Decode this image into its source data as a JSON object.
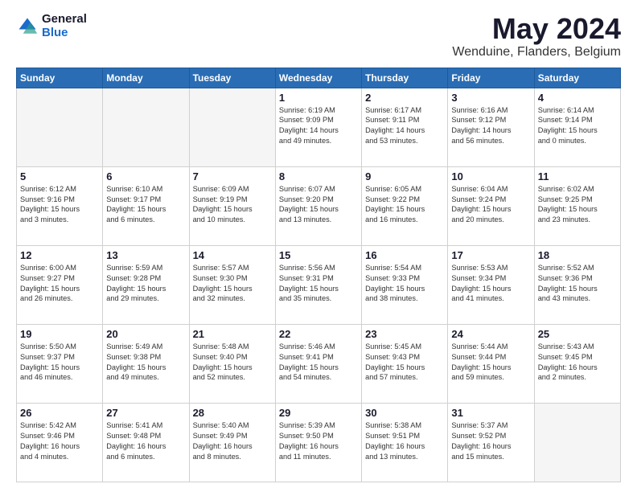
{
  "header": {
    "logo_general": "General",
    "logo_blue": "Blue",
    "month_title": "May 2024",
    "location": "Wenduine, Flanders, Belgium"
  },
  "days_of_week": [
    "Sunday",
    "Monday",
    "Tuesday",
    "Wednesday",
    "Thursday",
    "Friday",
    "Saturday"
  ],
  "weeks": [
    [
      {
        "day": "",
        "info": ""
      },
      {
        "day": "",
        "info": ""
      },
      {
        "day": "",
        "info": ""
      },
      {
        "day": "1",
        "info": "Sunrise: 6:19 AM\nSunset: 9:09 PM\nDaylight: 14 hours\nand 49 minutes."
      },
      {
        "day": "2",
        "info": "Sunrise: 6:17 AM\nSunset: 9:11 PM\nDaylight: 14 hours\nand 53 minutes."
      },
      {
        "day": "3",
        "info": "Sunrise: 6:16 AM\nSunset: 9:12 PM\nDaylight: 14 hours\nand 56 minutes."
      },
      {
        "day": "4",
        "info": "Sunrise: 6:14 AM\nSunset: 9:14 PM\nDaylight: 15 hours\nand 0 minutes."
      }
    ],
    [
      {
        "day": "5",
        "info": "Sunrise: 6:12 AM\nSunset: 9:16 PM\nDaylight: 15 hours\nand 3 minutes."
      },
      {
        "day": "6",
        "info": "Sunrise: 6:10 AM\nSunset: 9:17 PM\nDaylight: 15 hours\nand 6 minutes."
      },
      {
        "day": "7",
        "info": "Sunrise: 6:09 AM\nSunset: 9:19 PM\nDaylight: 15 hours\nand 10 minutes."
      },
      {
        "day": "8",
        "info": "Sunrise: 6:07 AM\nSunset: 9:20 PM\nDaylight: 15 hours\nand 13 minutes."
      },
      {
        "day": "9",
        "info": "Sunrise: 6:05 AM\nSunset: 9:22 PM\nDaylight: 15 hours\nand 16 minutes."
      },
      {
        "day": "10",
        "info": "Sunrise: 6:04 AM\nSunset: 9:24 PM\nDaylight: 15 hours\nand 20 minutes."
      },
      {
        "day": "11",
        "info": "Sunrise: 6:02 AM\nSunset: 9:25 PM\nDaylight: 15 hours\nand 23 minutes."
      }
    ],
    [
      {
        "day": "12",
        "info": "Sunrise: 6:00 AM\nSunset: 9:27 PM\nDaylight: 15 hours\nand 26 minutes."
      },
      {
        "day": "13",
        "info": "Sunrise: 5:59 AM\nSunset: 9:28 PM\nDaylight: 15 hours\nand 29 minutes."
      },
      {
        "day": "14",
        "info": "Sunrise: 5:57 AM\nSunset: 9:30 PM\nDaylight: 15 hours\nand 32 minutes."
      },
      {
        "day": "15",
        "info": "Sunrise: 5:56 AM\nSunset: 9:31 PM\nDaylight: 15 hours\nand 35 minutes."
      },
      {
        "day": "16",
        "info": "Sunrise: 5:54 AM\nSunset: 9:33 PM\nDaylight: 15 hours\nand 38 minutes."
      },
      {
        "day": "17",
        "info": "Sunrise: 5:53 AM\nSunset: 9:34 PM\nDaylight: 15 hours\nand 41 minutes."
      },
      {
        "day": "18",
        "info": "Sunrise: 5:52 AM\nSunset: 9:36 PM\nDaylight: 15 hours\nand 43 minutes."
      }
    ],
    [
      {
        "day": "19",
        "info": "Sunrise: 5:50 AM\nSunset: 9:37 PM\nDaylight: 15 hours\nand 46 minutes."
      },
      {
        "day": "20",
        "info": "Sunrise: 5:49 AM\nSunset: 9:38 PM\nDaylight: 15 hours\nand 49 minutes."
      },
      {
        "day": "21",
        "info": "Sunrise: 5:48 AM\nSunset: 9:40 PM\nDaylight: 15 hours\nand 52 minutes."
      },
      {
        "day": "22",
        "info": "Sunrise: 5:46 AM\nSunset: 9:41 PM\nDaylight: 15 hours\nand 54 minutes."
      },
      {
        "day": "23",
        "info": "Sunrise: 5:45 AM\nSunset: 9:43 PM\nDaylight: 15 hours\nand 57 minutes."
      },
      {
        "day": "24",
        "info": "Sunrise: 5:44 AM\nSunset: 9:44 PM\nDaylight: 15 hours\nand 59 minutes."
      },
      {
        "day": "25",
        "info": "Sunrise: 5:43 AM\nSunset: 9:45 PM\nDaylight: 16 hours\nand 2 minutes."
      }
    ],
    [
      {
        "day": "26",
        "info": "Sunrise: 5:42 AM\nSunset: 9:46 PM\nDaylight: 16 hours\nand 4 minutes."
      },
      {
        "day": "27",
        "info": "Sunrise: 5:41 AM\nSunset: 9:48 PM\nDaylight: 16 hours\nand 6 minutes."
      },
      {
        "day": "28",
        "info": "Sunrise: 5:40 AM\nSunset: 9:49 PM\nDaylight: 16 hours\nand 8 minutes."
      },
      {
        "day": "29",
        "info": "Sunrise: 5:39 AM\nSunset: 9:50 PM\nDaylight: 16 hours\nand 11 minutes."
      },
      {
        "day": "30",
        "info": "Sunrise: 5:38 AM\nSunset: 9:51 PM\nDaylight: 16 hours\nand 13 minutes."
      },
      {
        "day": "31",
        "info": "Sunrise: 5:37 AM\nSunset: 9:52 PM\nDaylight: 16 hours\nand 15 minutes."
      },
      {
        "day": "",
        "info": ""
      }
    ]
  ]
}
